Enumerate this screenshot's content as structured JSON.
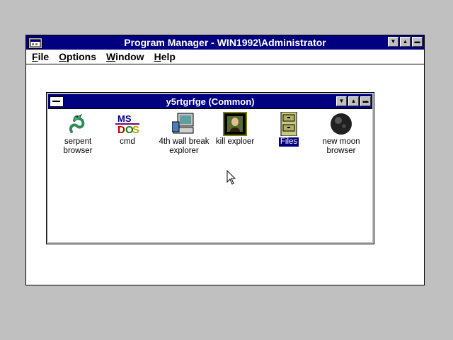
{
  "program_manager": {
    "title": "Program Manager - WIN1992\\Administrator",
    "menu": [
      {
        "label": "File",
        "mnemonic": "F"
      },
      {
        "label": "Options",
        "mnemonic": "O"
      },
      {
        "label": "Window",
        "mnemonic": "W"
      },
      {
        "label": "Help",
        "mnemonic": "H"
      }
    ],
    "title_bar_color": "#000080"
  },
  "group_window": {
    "title": "y5rtgrfge (Common)",
    "icons": [
      {
        "label_lines": [
          "serpent",
          "browser"
        ],
        "icon": "serpent-icon",
        "selected": false
      },
      {
        "label_lines": [
          "cmd"
        ],
        "icon": "msdos-icon",
        "selected": false
      },
      {
        "label_lines": [
          "4th wall break",
          "explorer"
        ],
        "icon": "computer-icon",
        "selected": false
      },
      {
        "label_lines": [
          "kill exploer"
        ],
        "icon": "mona-lisa-icon",
        "selected": false
      },
      {
        "label_lines": [
          "Files"
        ],
        "icon": "file-cabinet-icon",
        "selected": true
      },
      {
        "label_lines": [
          "new moon",
          "browser"
        ],
        "icon": "moon-icon",
        "selected": false
      }
    ]
  }
}
